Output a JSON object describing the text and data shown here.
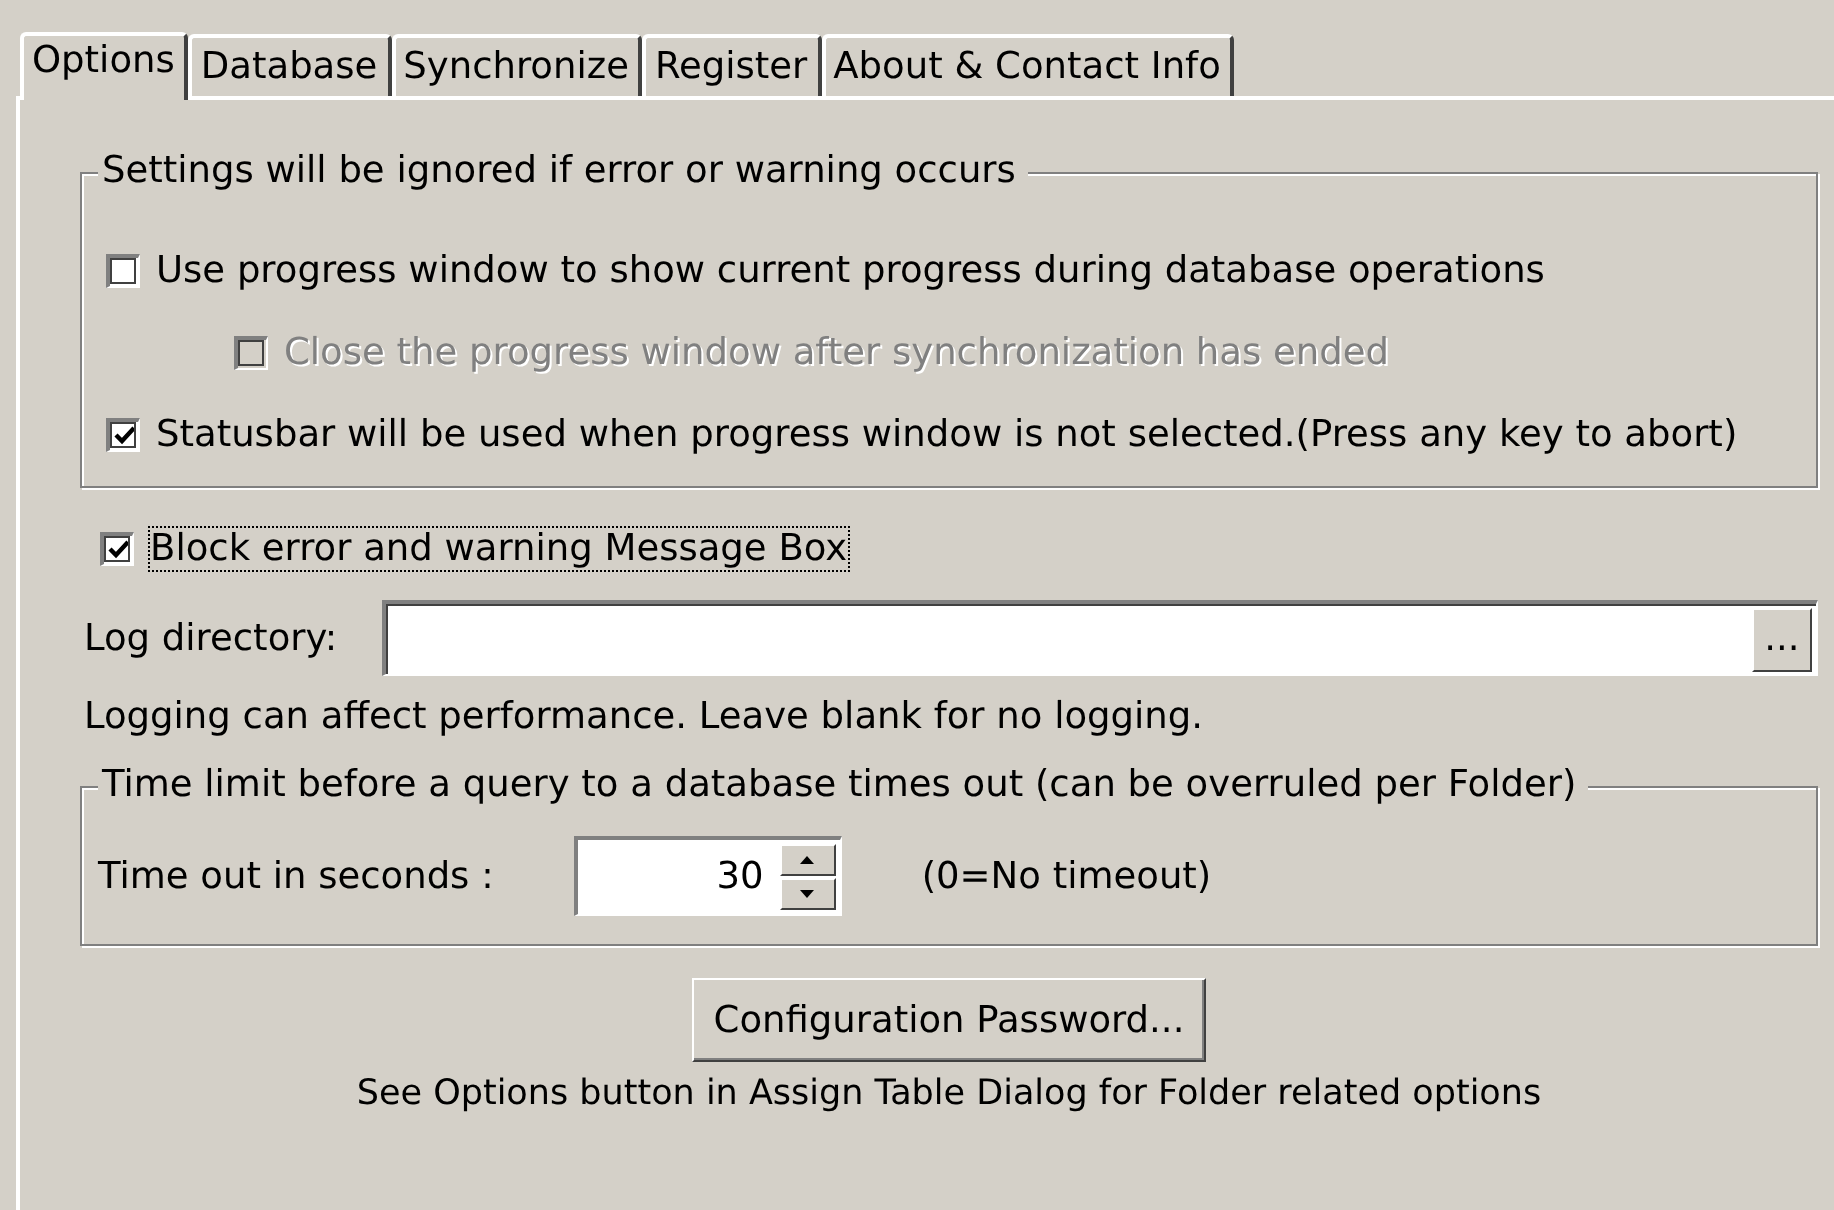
{
  "tabs": [
    {
      "label": "Options",
      "selected": true
    },
    {
      "label": "Database",
      "selected": false
    },
    {
      "label": "Synchronize",
      "selected": false
    },
    {
      "label": "Register",
      "selected": false
    },
    {
      "label": "About & Contact Info",
      "selected": false
    }
  ],
  "progress_group": {
    "title": "Settings will be ignored if error or warning occurs",
    "options": [
      {
        "label": "Use progress window to show current progress during database operations",
        "checked": false,
        "disabled": false,
        "children": [
          {
            "label": "Close the progress window after synchronization has ended",
            "checked": false,
            "disabled": true
          }
        ]
      },
      {
        "label": "Statusbar will be used when progress window is not selected.(Press any key to abort)",
        "checked": true,
        "disabled": false
      }
    ]
  },
  "block_option": {
    "label": "Block error and warning Message Box",
    "checked": true,
    "disabled": false,
    "focused": true
  },
  "log_directory": {
    "label": "Log directory:",
    "browse": "..."
  },
  "log_note": "Logging can affect performance. Leave blank for no logging.",
  "timeout_group": {
    "title": "Time limit before a query to a database times out (can be overruled per Folder)",
    "label": "Time out in seconds :",
    "value": "30",
    "hint": "(0=No timeout)"
  },
  "password_button": "Configuration Password...",
  "footer_note": "See Options button in Assign Table Dialog for Folder related options"
}
